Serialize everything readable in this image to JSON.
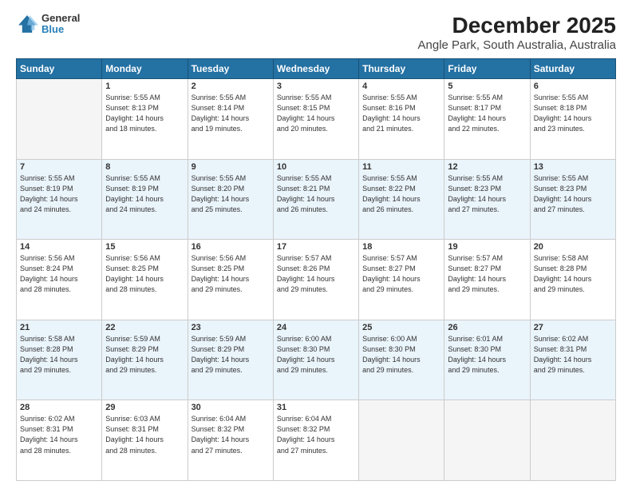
{
  "header": {
    "logo_line1": "General",
    "logo_line2": "Blue",
    "title": "December 2025",
    "subtitle": "Angle Park, South Australia, Australia"
  },
  "days_of_week": [
    "Sunday",
    "Monday",
    "Tuesday",
    "Wednesday",
    "Thursday",
    "Friday",
    "Saturday"
  ],
  "weeks": [
    [
      {
        "day": "",
        "info": ""
      },
      {
        "day": "1",
        "info": "Sunrise: 5:55 AM\nSunset: 8:13 PM\nDaylight: 14 hours\nand 18 minutes."
      },
      {
        "day": "2",
        "info": "Sunrise: 5:55 AM\nSunset: 8:14 PM\nDaylight: 14 hours\nand 19 minutes."
      },
      {
        "day": "3",
        "info": "Sunrise: 5:55 AM\nSunset: 8:15 PM\nDaylight: 14 hours\nand 20 minutes."
      },
      {
        "day": "4",
        "info": "Sunrise: 5:55 AM\nSunset: 8:16 PM\nDaylight: 14 hours\nand 21 minutes."
      },
      {
        "day": "5",
        "info": "Sunrise: 5:55 AM\nSunset: 8:17 PM\nDaylight: 14 hours\nand 22 minutes."
      },
      {
        "day": "6",
        "info": "Sunrise: 5:55 AM\nSunset: 8:18 PM\nDaylight: 14 hours\nand 23 minutes."
      }
    ],
    [
      {
        "day": "7",
        "info": "Sunrise: 5:55 AM\nSunset: 8:19 PM\nDaylight: 14 hours\nand 24 minutes."
      },
      {
        "day": "8",
        "info": "Sunrise: 5:55 AM\nSunset: 8:19 PM\nDaylight: 14 hours\nand 24 minutes."
      },
      {
        "day": "9",
        "info": "Sunrise: 5:55 AM\nSunset: 8:20 PM\nDaylight: 14 hours\nand 25 minutes."
      },
      {
        "day": "10",
        "info": "Sunrise: 5:55 AM\nSunset: 8:21 PM\nDaylight: 14 hours\nand 26 minutes."
      },
      {
        "day": "11",
        "info": "Sunrise: 5:55 AM\nSunset: 8:22 PM\nDaylight: 14 hours\nand 26 minutes."
      },
      {
        "day": "12",
        "info": "Sunrise: 5:55 AM\nSunset: 8:23 PM\nDaylight: 14 hours\nand 27 minutes."
      },
      {
        "day": "13",
        "info": "Sunrise: 5:55 AM\nSunset: 8:23 PM\nDaylight: 14 hours\nand 27 minutes."
      }
    ],
    [
      {
        "day": "14",
        "info": "Sunrise: 5:56 AM\nSunset: 8:24 PM\nDaylight: 14 hours\nand 28 minutes."
      },
      {
        "day": "15",
        "info": "Sunrise: 5:56 AM\nSunset: 8:25 PM\nDaylight: 14 hours\nand 28 minutes."
      },
      {
        "day": "16",
        "info": "Sunrise: 5:56 AM\nSunset: 8:25 PM\nDaylight: 14 hours\nand 29 minutes."
      },
      {
        "day": "17",
        "info": "Sunrise: 5:57 AM\nSunset: 8:26 PM\nDaylight: 14 hours\nand 29 minutes."
      },
      {
        "day": "18",
        "info": "Sunrise: 5:57 AM\nSunset: 8:27 PM\nDaylight: 14 hours\nand 29 minutes."
      },
      {
        "day": "19",
        "info": "Sunrise: 5:57 AM\nSunset: 8:27 PM\nDaylight: 14 hours\nand 29 minutes."
      },
      {
        "day": "20",
        "info": "Sunrise: 5:58 AM\nSunset: 8:28 PM\nDaylight: 14 hours\nand 29 minutes."
      }
    ],
    [
      {
        "day": "21",
        "info": "Sunrise: 5:58 AM\nSunset: 8:28 PM\nDaylight: 14 hours\nand 29 minutes."
      },
      {
        "day": "22",
        "info": "Sunrise: 5:59 AM\nSunset: 8:29 PM\nDaylight: 14 hours\nand 29 minutes."
      },
      {
        "day": "23",
        "info": "Sunrise: 5:59 AM\nSunset: 8:29 PM\nDaylight: 14 hours\nand 29 minutes."
      },
      {
        "day": "24",
        "info": "Sunrise: 6:00 AM\nSunset: 8:30 PM\nDaylight: 14 hours\nand 29 minutes."
      },
      {
        "day": "25",
        "info": "Sunrise: 6:00 AM\nSunset: 8:30 PM\nDaylight: 14 hours\nand 29 minutes."
      },
      {
        "day": "26",
        "info": "Sunrise: 6:01 AM\nSunset: 8:30 PM\nDaylight: 14 hours\nand 29 minutes."
      },
      {
        "day": "27",
        "info": "Sunrise: 6:02 AM\nSunset: 8:31 PM\nDaylight: 14 hours\nand 29 minutes."
      }
    ],
    [
      {
        "day": "28",
        "info": "Sunrise: 6:02 AM\nSunset: 8:31 PM\nDaylight: 14 hours\nand 28 minutes."
      },
      {
        "day": "29",
        "info": "Sunrise: 6:03 AM\nSunset: 8:31 PM\nDaylight: 14 hours\nand 28 minutes."
      },
      {
        "day": "30",
        "info": "Sunrise: 6:04 AM\nSunset: 8:32 PM\nDaylight: 14 hours\nand 27 minutes."
      },
      {
        "day": "31",
        "info": "Sunrise: 6:04 AM\nSunset: 8:32 PM\nDaylight: 14 hours\nand 27 minutes."
      },
      {
        "day": "",
        "info": ""
      },
      {
        "day": "",
        "info": ""
      },
      {
        "day": "",
        "info": ""
      }
    ]
  ]
}
